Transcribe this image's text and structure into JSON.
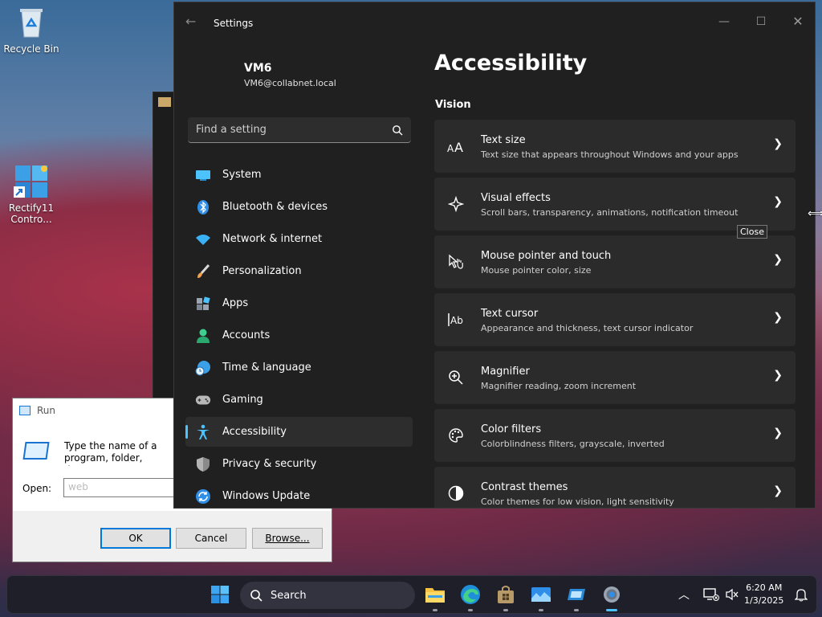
{
  "desktop": {
    "icons": [
      {
        "label": "Recycle Bin"
      },
      {
        "label": "Rectify11 Contro..."
      }
    ]
  },
  "run_dialog": {
    "title": "Run",
    "message": "Type the name of a program, folder, document, or Internet resource, and Windows will open it for you.",
    "open_label": "Open:",
    "input_placeholder": "web",
    "ok_label": "OK",
    "cancel_label": "Cancel",
    "browse_label": "Browse..."
  },
  "settings": {
    "window_title": "Settings",
    "user": {
      "name": "VM6",
      "email": "VM6@collabnet.local"
    },
    "search_placeholder": "Find a setting",
    "nav": [
      {
        "label": "System",
        "icon": "system-icon",
        "color": "#4cc2ff"
      },
      {
        "label": "Bluetooth & devices",
        "icon": "bluetooth-icon",
        "color": "#2f8fe8"
      },
      {
        "label": "Network & internet",
        "icon": "wifi-icon",
        "color": "#3ab0f5"
      },
      {
        "label": "Personalization",
        "icon": "brush-icon",
        "color": "#f0a250"
      },
      {
        "label": "Apps",
        "icon": "apps-icon",
        "color": "#9aa4b2"
      },
      {
        "label": "Accounts",
        "icon": "person-icon",
        "color": "#3ecf8e"
      },
      {
        "label": "Time & language",
        "icon": "globe-clock-icon",
        "color": "#3aa0e8"
      },
      {
        "label": "Gaming",
        "icon": "gamepad-icon",
        "color": "#b8b8b8"
      },
      {
        "label": "Accessibility",
        "icon": "accessibility-icon",
        "color": "#4cc2ff",
        "active": true
      },
      {
        "label": "Privacy & security",
        "icon": "shield-icon",
        "color": "#8a8a8a"
      },
      {
        "label": "Windows Update",
        "icon": "update-icon",
        "color": "#2f8fe8"
      }
    ],
    "page_title": "Accessibility",
    "section_title": "Vision",
    "cards": [
      {
        "title": "Text size",
        "subtitle": "Text size that appears throughout Windows and your apps",
        "icon": "text-size-icon"
      },
      {
        "title": "Visual effects",
        "subtitle": "Scroll bars, transparency, animations, notification timeout",
        "icon": "sparkle-icon"
      },
      {
        "title": "Mouse pointer and touch",
        "subtitle": "Mouse pointer color, size",
        "icon": "pointer-touch-icon"
      },
      {
        "title": "Text cursor",
        "subtitle": "Appearance and thickness, text cursor indicator",
        "icon": "text-cursor-icon"
      },
      {
        "title": "Magnifier",
        "subtitle": "Magnifier reading, zoom increment",
        "icon": "magnifier-icon"
      },
      {
        "title": "Color filters",
        "subtitle": "Colorblindness filters, grayscale, inverted",
        "icon": "palette-icon"
      },
      {
        "title": "Contrast themes",
        "subtitle": "Color themes for low vision, light sensitivity",
        "icon": "contrast-icon"
      }
    ],
    "tooltip": "Close"
  },
  "taskbar": {
    "search_label": "Search",
    "time": "6:20 AM",
    "date": "1/3/2025"
  }
}
